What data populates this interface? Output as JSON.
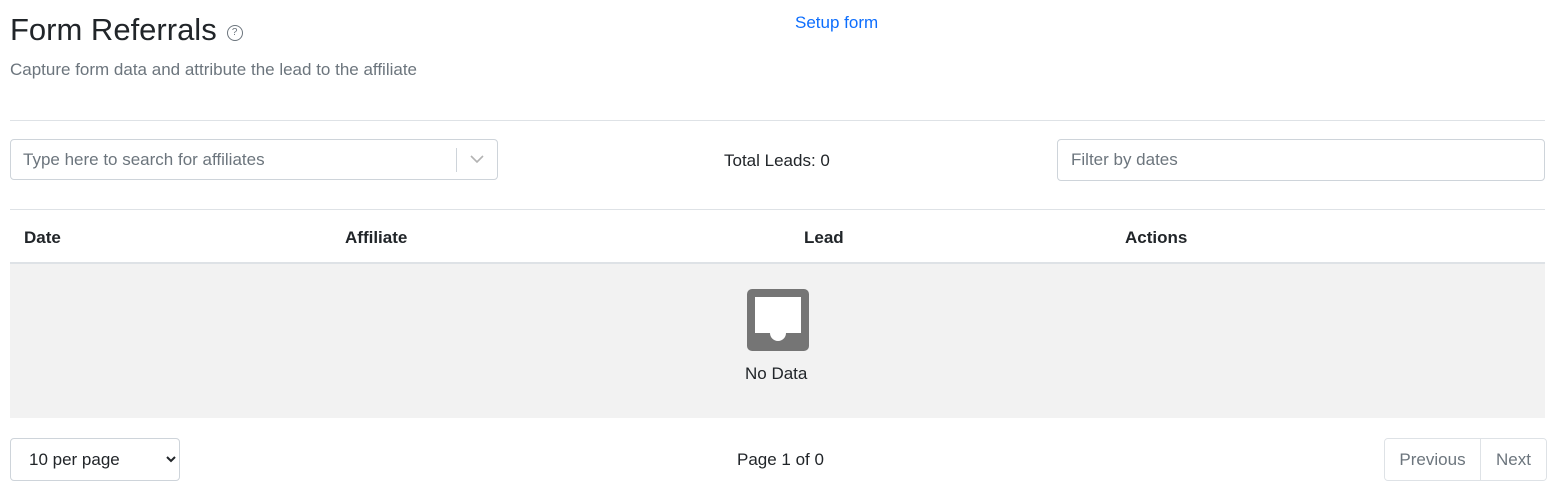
{
  "header": {
    "title": "Form Referrals",
    "help_icon_text": "?",
    "setup_link": "Setup form",
    "subtitle": "Capture form data and attribute the lead to the affiliate"
  },
  "filters": {
    "search_placeholder": "Type here to search for affiliates",
    "total_leads": "Total Leads: 0",
    "date_placeholder": "Filter by dates"
  },
  "table": {
    "columns": [
      "Date",
      "Affiliate",
      "Lead",
      "Actions"
    ],
    "empty_text": "No Data"
  },
  "pagination": {
    "per_page_options": [
      "10 per page"
    ],
    "page_info": "Page 1 of 0",
    "previous_label": "Previous",
    "next_label": "Next"
  },
  "colors": {
    "link": "#0d6efd",
    "empty_bg": "#f2f2f2",
    "icon": "#757575"
  }
}
